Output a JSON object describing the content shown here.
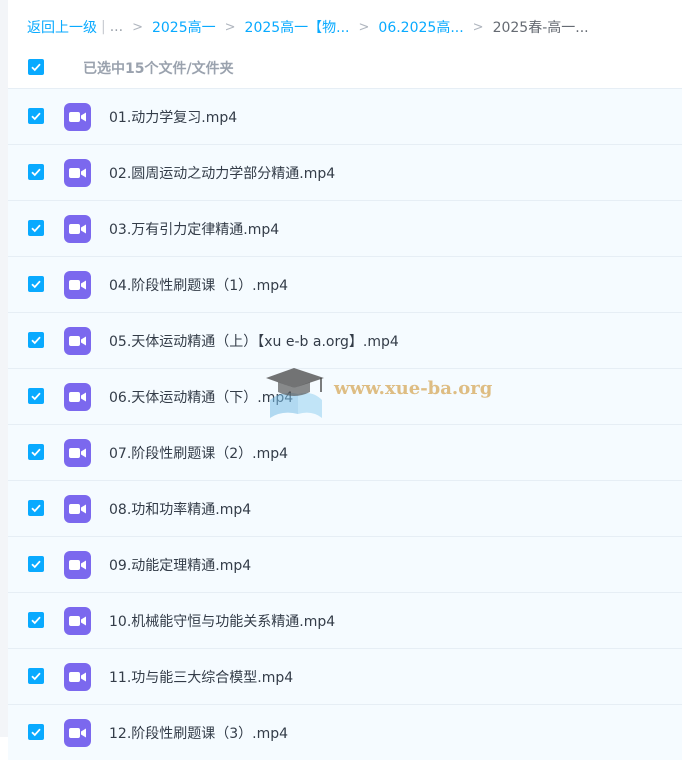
{
  "breadcrumb": {
    "back": "返回上一级",
    "separator": "|",
    "ellipsis": "...",
    "chevron": ">",
    "crumbs": [
      "2025高一",
      "2025高一【物...",
      "06.2025高...",
      "2025春-高一..."
    ]
  },
  "selection": {
    "label": "已选中15个文件/文件夹",
    "all_checked": true
  },
  "files": [
    {
      "name": "01.动力学复习.mp4",
      "checked": true
    },
    {
      "name": "02.圆周运动之动力学部分精通.mp4",
      "checked": true
    },
    {
      "name": "03.万有引力定律精通.mp4",
      "checked": true
    },
    {
      "name": "04.阶段性刷题课（1）.mp4",
      "checked": true
    },
    {
      "name": "05.天体运动精通（上）【xu e-b a.org】.mp4",
      "checked": true
    },
    {
      "name": "06.天体运动精通（下）.mp4",
      "checked": true
    },
    {
      "name": "07.阶段性刷题课（2）.mp4",
      "checked": true
    },
    {
      "name": "08.功和功率精通.mp4",
      "checked": true
    },
    {
      "name": "09.动能定理精通.mp4",
      "checked": true
    },
    {
      "name": "10.机械能守恒与功能关系精通.mp4",
      "checked": true
    },
    {
      "name": "11.功与能三大综合模型.mp4",
      "checked": true
    },
    {
      "name": "12.阶段性刷题课（3）.mp4",
      "checked": true
    }
  ],
  "watermark": {
    "text": "www.xue-ba.org"
  },
  "colors": {
    "accent": "#09aaff",
    "video_icon": "#7b68ee",
    "row_bg": "#f5fbff"
  }
}
